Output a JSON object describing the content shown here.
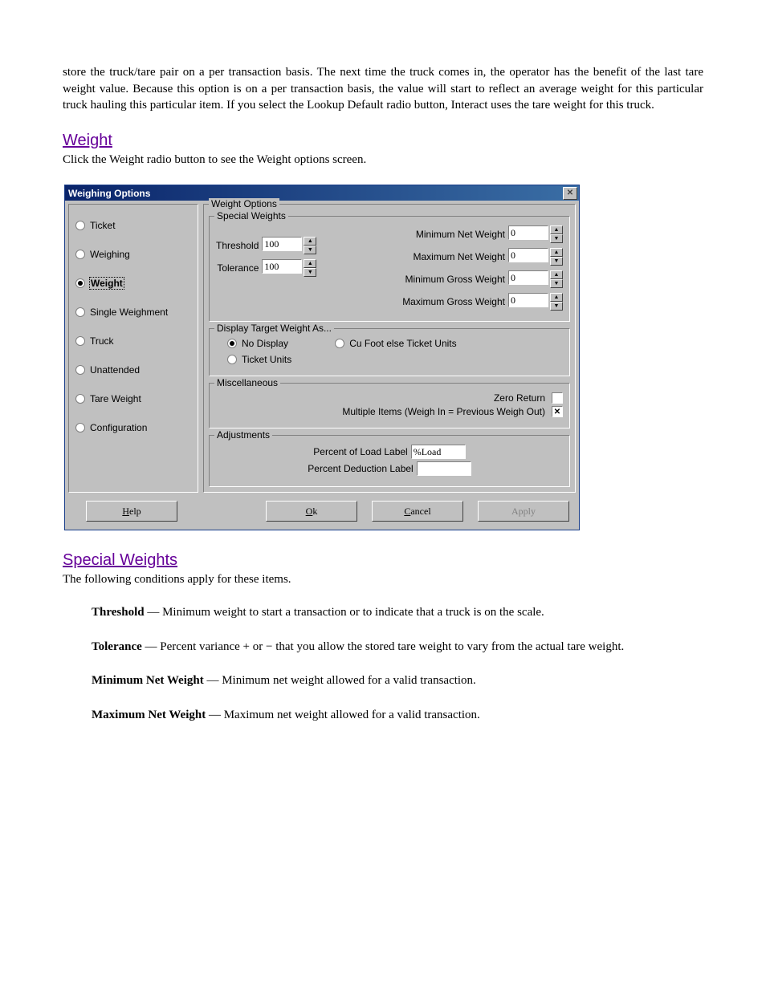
{
  "intro_paragraph": "store the truck/tare pair on a per transaction basis. The next time the truck comes in, the operator has the benefit of the last tare weight value. Because this option is on a per transaction basis, the value will start to reflect an average weight for this particular truck hauling this particular item. If you select the Lookup Default radio button, Interact uses the tare weight for this truck.",
  "headings": {
    "weight": {
      "title": "Weight",
      "subtitle": "Click the Weight radio button to see the Weight options screen."
    },
    "special": {
      "title": "Special Weights",
      "subtitle": "The following conditions apply for these items."
    }
  },
  "dialog": {
    "title": "Weighing Options",
    "sidebar": [
      {
        "label": "Ticket",
        "selected": false
      },
      {
        "label": "Weighing",
        "selected": false
      },
      {
        "label": "Weight",
        "selected": true
      },
      {
        "label": "Single Weighment",
        "selected": false
      },
      {
        "label": "Truck",
        "selected": false
      },
      {
        "label": "Unattended",
        "selected": false
      },
      {
        "label": "Tare Weight",
        "selected": false
      },
      {
        "label": "Configuration",
        "selected": false
      }
    ],
    "outer_legend": "Weight Options",
    "groups": {
      "special": {
        "legend": "Special Weights",
        "threshold_label": "Threshold",
        "threshold_value": "100",
        "tolerance_label": "Tolerance",
        "tolerance_value": "100",
        "min_net_label": "Minimum Net Weight",
        "min_net_value": "0",
        "max_net_label": "Maximum Net Weight",
        "max_net_value": "0",
        "min_gross_label": "Minimum Gross Weight",
        "min_gross_value": "0",
        "max_gross_label": "Maximum Gross Weight",
        "max_gross_value": "0"
      },
      "target": {
        "legend": "Display Target Weight As...",
        "no_display": "No Display",
        "ticket_units": "Ticket Units",
        "cu_foot": "Cu Foot else Ticket Units"
      },
      "misc": {
        "legend": "Miscellaneous",
        "zero_return": "Zero Return",
        "multi_items": "Multiple Items (Weigh In = Previous Weigh Out)"
      },
      "adjust": {
        "legend": "Adjustments",
        "pct_load_label": "Percent of Load Label",
        "pct_load_value": "%Load",
        "pct_deduct_label": "Percent Deduction Label",
        "pct_deduct_value": ""
      }
    },
    "buttons": {
      "help": "Help",
      "ok": "Ok",
      "cancel": "Cancel",
      "apply": "Apply"
    }
  },
  "special_list": [
    {
      "label": "Threshold",
      "desc": "Minimum weight to start a transaction or to indicate that a truck is on the scale."
    },
    {
      "label": "Tolerance",
      "desc": "Percent variance + or − that you allow the stored tare weight to vary from the actual tare weight."
    },
    {
      "label": "Minimum Net Weight",
      "desc": "Minimum net weight allowed for a valid transaction."
    },
    {
      "label": "Maximum Net Weight",
      "desc": "Maximum net weight allowed for a valid transaction."
    }
  ]
}
